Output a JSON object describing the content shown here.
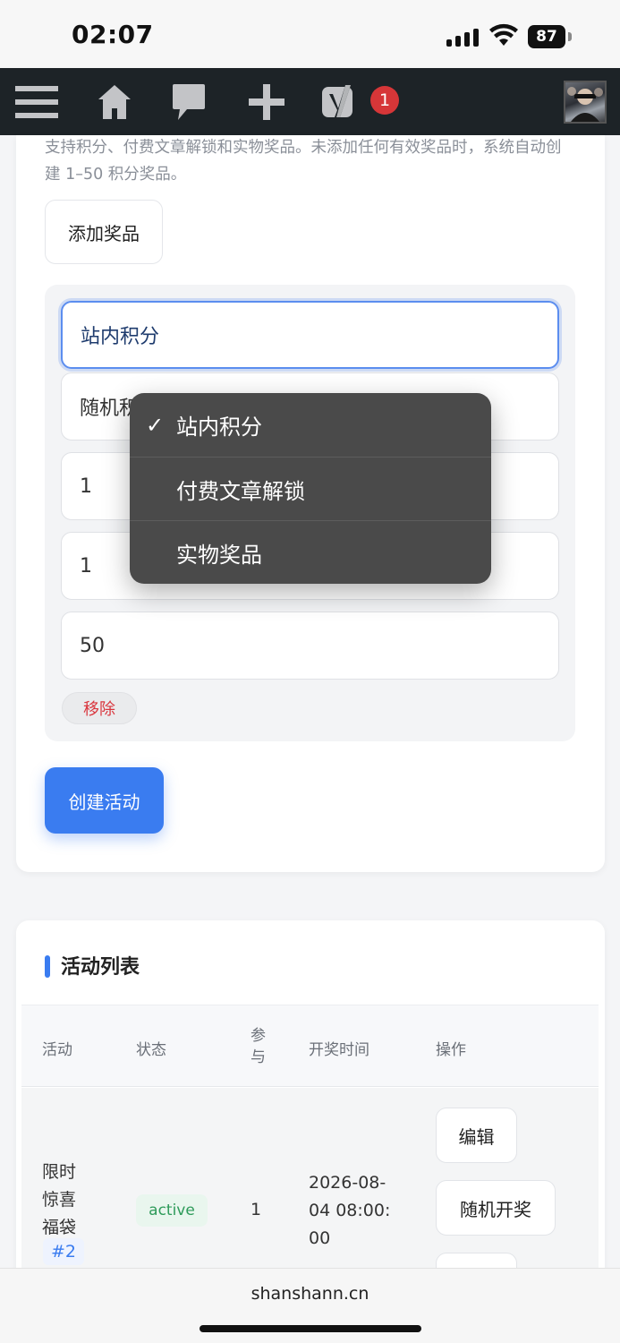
{
  "status_bar": {
    "time": "02:07",
    "battery": "87"
  },
  "admin_bar": {
    "menu_icon": "hamburger-menu-icon",
    "home_icon": "home-icon",
    "comments_icon": "comment-bubble-icon",
    "new_icon": "plus-icon",
    "yoast_icon": "yoast-seo-icon",
    "notification_count": "1",
    "avatar": "user-avatar"
  },
  "prize_form": {
    "help_text": "支持积分、付费文章解锁和实物奖品。未添加任何有效奖品时，系统自动创建 1–50 积分奖品。",
    "add_prize_label": "添加奖品",
    "prize_type_value": "站内积分",
    "prize_mode_value": "随机积",
    "field_3_value": "1",
    "field_4_value": "1",
    "field_5_value": "50",
    "remove_label": "移除",
    "create_label": "创建活动"
  },
  "dropdown": {
    "check": "✓",
    "options": [
      "站内积分",
      "付费文章解锁",
      "实物奖品"
    ],
    "selected": "站内积分"
  },
  "activity_list": {
    "title": "活动列表",
    "headers": {
      "activity": "活动",
      "status": "状态",
      "participants": "参与",
      "draw_time": "开奖时间",
      "actions": "操作"
    },
    "rows": [
      {
        "name": "限时惊喜福袋",
        "id": "#2",
        "status": "active",
        "participants": "1",
        "draw_time": "2026-08-04 08:00:00",
        "actions": [
          "编辑",
          "随机开奖"
        ]
      }
    ]
  },
  "browser": {
    "url": "shanshann.cn"
  },
  "colors": {
    "accent": "#3a7cf0",
    "admin_bar": "#1d2327",
    "danger": "#d9363e",
    "success": "#2e9b5a"
  }
}
